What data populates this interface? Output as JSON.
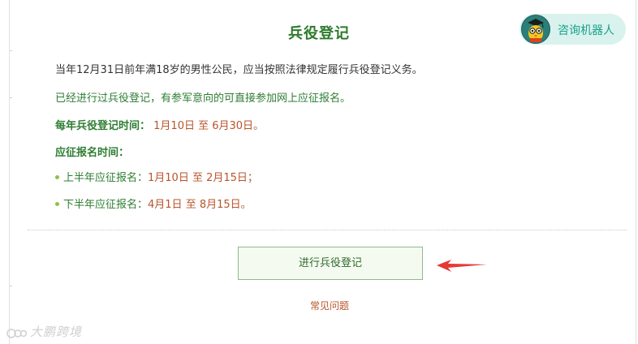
{
  "page": {
    "title": "兵役登记"
  },
  "robot": {
    "label": "咨询机器人"
  },
  "content": {
    "line1": "当年12月31日前年满18岁的男性公民，应当按照法律规定履行兵役登记义务。",
    "line2": "已经进行过兵役登记，有参军意向的可直接参加网上应征报名。",
    "reg_time_label": "每年兵役登记时间：",
    "reg_time_value": "1月10日 至 6月30日。",
    "apply_time_label": "应征报名时间：",
    "first_half_label": "上半年应征报名：",
    "first_half_value": "1月10日 至 2月15日；",
    "second_half_label": "下半年应征报名：",
    "second_half_value": "4月1日 至 8月15日。"
  },
  "actions": {
    "register_label": "进行兵役登记",
    "faq_label": "常见问题"
  },
  "watermark": {
    "text": "大鹏跨境"
  },
  "colors": {
    "title": "#2d7a2d",
    "accent_green": "#2e7d32",
    "date_red": "#b8542a",
    "arrow_red": "#e53935",
    "robot_bg": "#d9f2ee"
  }
}
